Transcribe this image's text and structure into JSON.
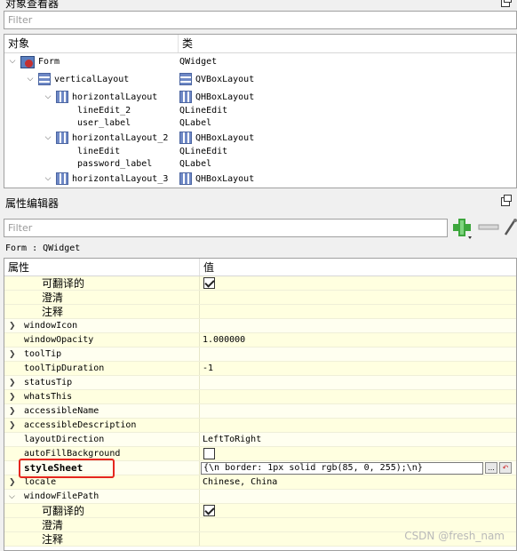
{
  "object_inspector": {
    "title": "对象查看器",
    "filter_placeholder": "Filter",
    "columns": [
      "对象",
      "类"
    ],
    "rows": [
      {
        "name": "Form",
        "cls": "QWidget"
      },
      {
        "name": "verticalLayout",
        "cls": "QVBoxLayout"
      },
      {
        "name": "horizontalLayout",
        "cls": "QHBoxLayout"
      },
      {
        "name": "lineEdit_2",
        "cls": "QLineEdit"
      },
      {
        "name": "user_label",
        "cls": "QLabel"
      },
      {
        "name": "horizontalLayout_2",
        "cls": "QHBoxLayout"
      },
      {
        "name": "lineEdit",
        "cls": "QLineEdit"
      },
      {
        "name": "password_label",
        "cls": "QLabel"
      },
      {
        "name": "horizontalLayout_3",
        "cls": "QHBoxLayout"
      }
    ]
  },
  "property_editor": {
    "title": "属性编辑器",
    "filter_placeholder": "Filter",
    "context": "Form : QWidget",
    "columns": [
      "属性",
      "值"
    ],
    "rows": [
      {
        "name": "可翻译的",
        "value": ""
      },
      {
        "name": "澄清",
        "value": ""
      },
      {
        "name": "注释",
        "value": ""
      },
      {
        "name": "windowIcon",
        "value": ""
      },
      {
        "name": "windowOpacity",
        "value": "1.000000"
      },
      {
        "name": "toolTip",
        "value": ""
      },
      {
        "name": "toolTipDuration",
        "value": "-1"
      },
      {
        "name": "statusTip",
        "value": ""
      },
      {
        "name": "whatsThis",
        "value": ""
      },
      {
        "name": "accessibleName",
        "value": ""
      },
      {
        "name": "accessibleDescription",
        "value": ""
      },
      {
        "name": "layoutDirection",
        "value": "LeftToRight"
      },
      {
        "name": "autoFillBackground",
        "value": ""
      },
      {
        "name": "styleSheet",
        "value": "{\\n        border: 1px solid  rgb(85, 0, 255);\\n}"
      },
      {
        "name": "locale",
        "value": "Chinese, China"
      },
      {
        "name": "windowFilePath",
        "value": ""
      },
      {
        "name": "可翻译的",
        "value": ""
      },
      {
        "name": "澄清",
        "value": ""
      },
      {
        "name": "注释",
        "value": ""
      }
    ],
    "stylesheet_more_button": "...",
    "autofill_checked": false,
    "translatable_checked": true
  },
  "watermark": "CSDN @fresh_nam"
}
